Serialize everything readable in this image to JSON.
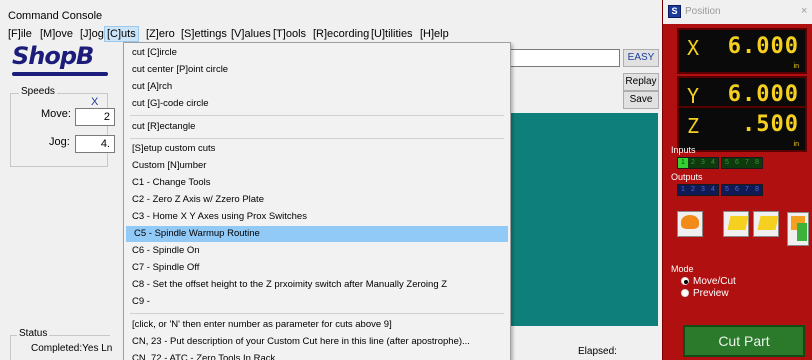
{
  "console": {
    "title": "Command Console",
    "menu": [
      "[F]ile",
      "[M]ove",
      "[J]og",
      "[C]uts",
      "[Z]ero",
      "[S]ettings",
      "[V]alues",
      "[T]ools",
      "[R]ecording",
      "[U]tilities",
      "[H]elp"
    ],
    "logo_text": "ShopB",
    "speeds": {
      "legend": "Speeds",
      "column_label": "X &",
      "move_label": "Move:",
      "move_value": "2",
      "jog_label": "Jog:",
      "jog_value": "4."
    },
    "buttons": {
      "easy": "EASY",
      "replay": "Replay",
      "save": "Save"
    },
    "status": {
      "legend": "Status",
      "text": "Completed:Yes Ln"
    },
    "elapsed": "Elapsed:",
    "teal_color": "#0e7f7a"
  },
  "cuts_menu": {
    "items": [
      "cut [C]ircle",
      "cut center [P]oint circle",
      "cut [A]rch",
      "cut [G]-code circle",
      "cut [R]ectangle",
      "[S]etup custom cuts",
      "Custom [N]umber",
      "C1  -  Change Tools",
      "C2  -  Zero Z Axis w/ Zzero Plate",
      "C3  -  Home X  Y Axes using Prox Switches",
      "C5  -  Spindle Warmup Routine",
      "C6  -  Spindle On",
      "C7  -  Spindle Off",
      "C8  -  Set the offset height to the Z prxoimity switch after Manually Zeroing Z",
      "C9  -",
      "[click, or 'N' then enter number as parameter for cuts above 9]",
      "CN, 23  -  Put description of your Custom Cut here in this line (after apostrophe)...",
      "CN, 72  -  ATC - Zero Tools In Rack"
    ],
    "highlighted_index": 10,
    "highlight_color": "#91c9f7"
  },
  "position": {
    "title": "Position",
    "close": "×",
    "axes": [
      {
        "letter": "X",
        "value": "6.000",
        "unit": "in"
      },
      {
        "letter": "Y",
        "value": "6.000",
        "unit": "in"
      },
      {
        "letter": "Z",
        "value": ".500",
        "unit": "in"
      }
    ],
    "inputs_label": "Inputs",
    "inputs_active": [
      "1"
    ],
    "outputs_label": "Outputs",
    "io_group1": [
      "1",
      "2",
      "3",
      "4"
    ],
    "io_group2": [
      "5",
      "6",
      "7",
      "8"
    ],
    "mode_label": "Mode",
    "modes": [
      "Move/Cut",
      "Preview"
    ],
    "selected_mode": "Move/Cut",
    "cut_part_label": "Cut Part",
    "panel_color": "#b01010",
    "led_color": "#f5d020",
    "cut_part_color": "#2b7a2b"
  }
}
